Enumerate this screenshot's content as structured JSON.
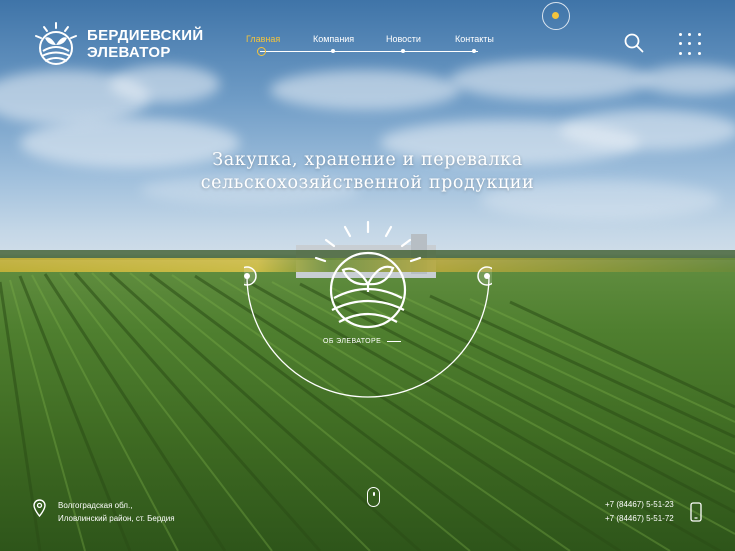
{
  "brand": {
    "line1": "БЕРДИЕВСКИЙ",
    "line2": "ЭЛЕВАТОР"
  },
  "nav": {
    "items": [
      {
        "label": "Главная",
        "active": true
      },
      {
        "label": "Компания",
        "active": false
      },
      {
        "label": "Новости",
        "active": false
      },
      {
        "label": "Контакты",
        "active": false
      }
    ]
  },
  "hero": {
    "headline_line1": "Закупка, хранение и перевалка",
    "headline_line2": "сельскохозяйственной продукции",
    "about_link": "ОБ ЭЛЕВАТОРЕ"
  },
  "footer": {
    "address_line1": "Волгоградская обл.,",
    "address_line2": "Иловлинский район, ст. Бердия",
    "phone1": "+7 (84467) 5-51-23",
    "phone2": "+7 (84467) 5-51-72"
  },
  "icons": {
    "search": "search-icon",
    "menu": "grid-menu-icon",
    "location": "map-pin-icon",
    "phone": "mobile-phone-icon",
    "scroll": "mouse-scroll-icon",
    "sun": "sun-toggle-icon"
  },
  "colors": {
    "accent": "#f3c43d",
    "text": "#ffffff"
  }
}
